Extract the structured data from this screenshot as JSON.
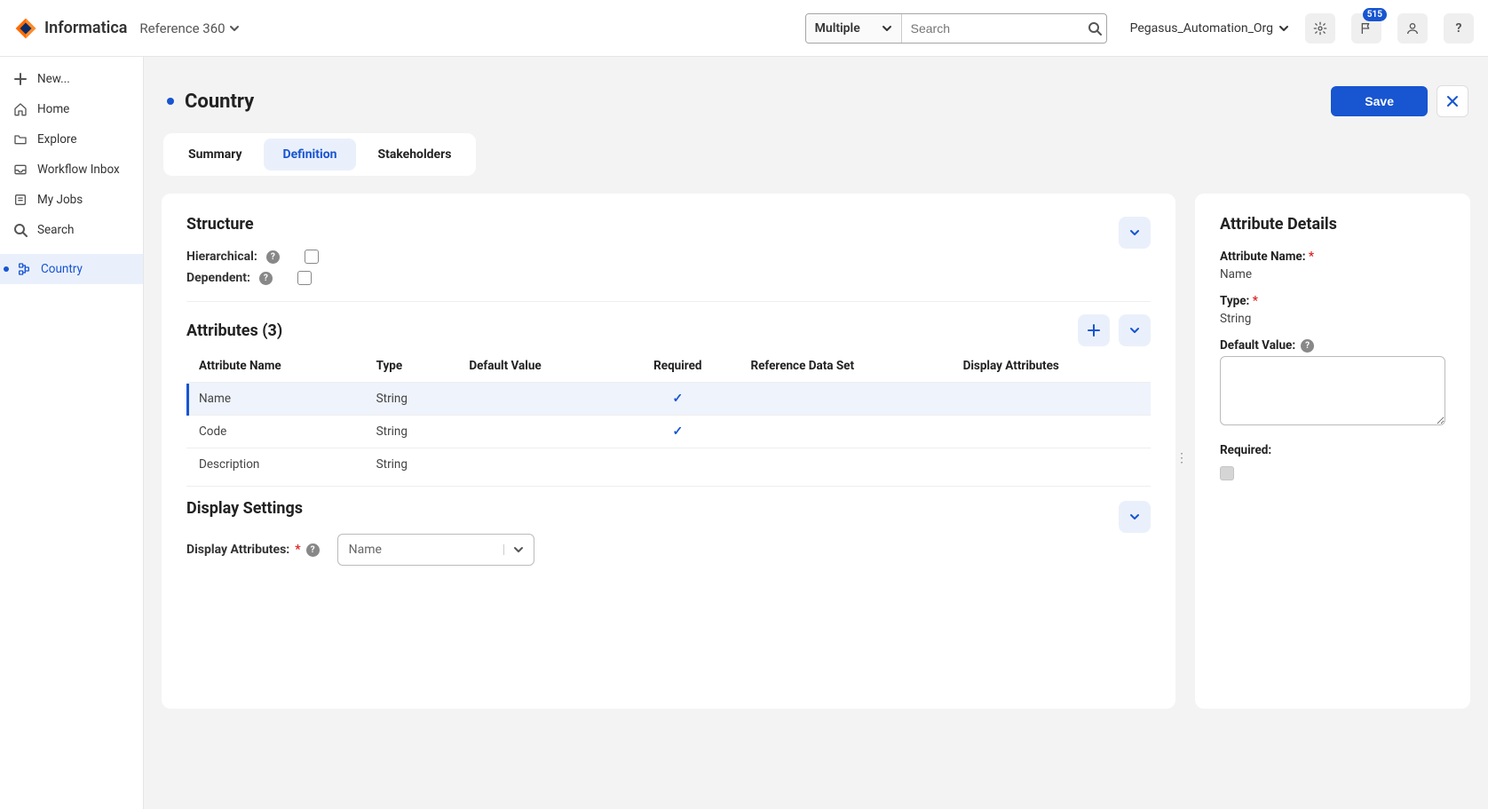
{
  "brand": {
    "name": "Informatica",
    "app": "Reference 360"
  },
  "header": {
    "search_scope": "Multiple",
    "search_placeholder": "Search",
    "org_name": "Pegasus_Automation_Org",
    "notif_badge": "515"
  },
  "sidebar": {
    "new_label": "New...",
    "items": [
      {
        "icon": "home",
        "label": "Home"
      },
      {
        "icon": "folder",
        "label": "Explore"
      },
      {
        "icon": "inbox",
        "label": "Workflow Inbox"
      },
      {
        "icon": "jobs",
        "label": "My Jobs"
      },
      {
        "icon": "search",
        "label": "Search"
      }
    ],
    "open_tab": {
      "label": "Country"
    }
  },
  "page": {
    "title": "Country",
    "save_label": "Save",
    "tabs": [
      "Summary",
      "Definition",
      "Stakeholders"
    ]
  },
  "structure": {
    "heading": "Structure",
    "hierarchical_label": "Hierarchical:",
    "dependent_label": "Dependent:"
  },
  "attributes": {
    "heading": "Attributes (3)",
    "columns": [
      "Attribute Name",
      "Type",
      "Default Value",
      "Required",
      "Reference Data Set",
      "Display Attributes"
    ],
    "rows": [
      {
        "name": "Name",
        "type": "String",
        "default": "",
        "required": true,
        "rds": "",
        "disp": ""
      },
      {
        "name": "Code",
        "type": "String",
        "default": "",
        "required": true,
        "rds": "",
        "disp": ""
      },
      {
        "name": "Description",
        "type": "String",
        "default": "",
        "required": false,
        "rds": "",
        "disp": ""
      }
    ]
  },
  "display_settings": {
    "heading": "Display Settings",
    "label": "Display Attributes:",
    "value": "Name"
  },
  "details": {
    "heading": "Attribute Details",
    "name_label": "Attribute Name:",
    "name_value": "Name",
    "type_label": "Type:",
    "type_value": "String",
    "default_label": "Default Value:",
    "default_value": "",
    "required_label": "Required:"
  }
}
